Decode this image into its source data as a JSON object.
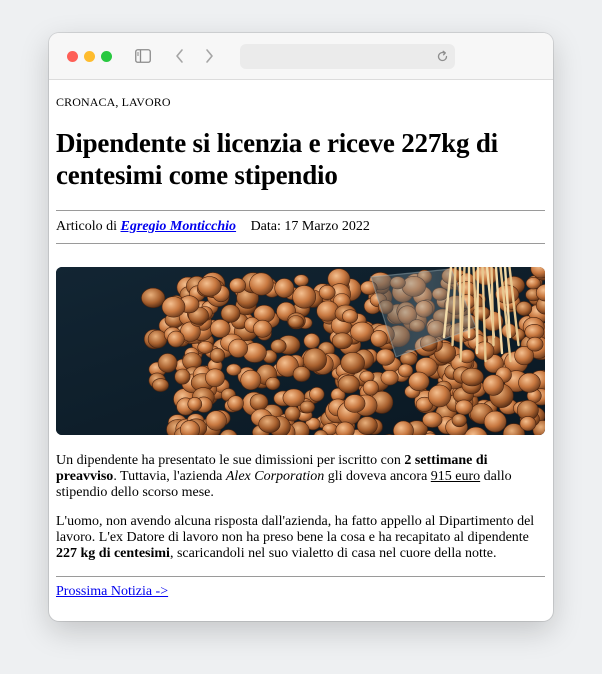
{
  "article": {
    "category": "CRONACA, LAVORO",
    "title": "Dipendente si licenzia e riceve 227kg di centesimi come stipendio",
    "byline_prefix": "Articolo di",
    "author": "Egregio Monticchio",
    "date_label": "Data:",
    "date": "17 Marzo 2022",
    "paragraph1": {
      "t1": "Un dipendente ha presentato le sue dimissioni per iscritto con ",
      "b1": "2 settimane di preavviso",
      "t2": ". Tuttavia, l'azienda ",
      "company": "Alex Corporation",
      "t3": " gli doveva ancora ",
      "amount": "915 euro",
      "t4": " dallo stipendio dello scorso mese."
    },
    "paragraph2": {
      "t1": "L'uomo, non avendo alcuna risposta dall'azienda, ha fatto appello al Dipartimento del lavoro. L'ex Datore di lavoro non ha preso bene la cosa e ha recapitato al dipendente ",
      "b1": "227 kg di centesimi",
      "t2": ", scaricandoli nel suo vialetto di casa nel cuore della notte."
    },
    "next_link": "Prossima Notizia ->"
  },
  "icons": {
    "sidebar": "sidebar-toggle-icon",
    "back": "chevron-left-icon",
    "forward": "chevron-right-icon",
    "reload": "reload-icon"
  },
  "colors": {
    "link": "#0000ee",
    "close": "#fe5f57",
    "minimize": "#febc2e",
    "zoom": "#28c840",
    "coin_copper": "#c87840",
    "hero_background": "#0e1e28"
  }
}
